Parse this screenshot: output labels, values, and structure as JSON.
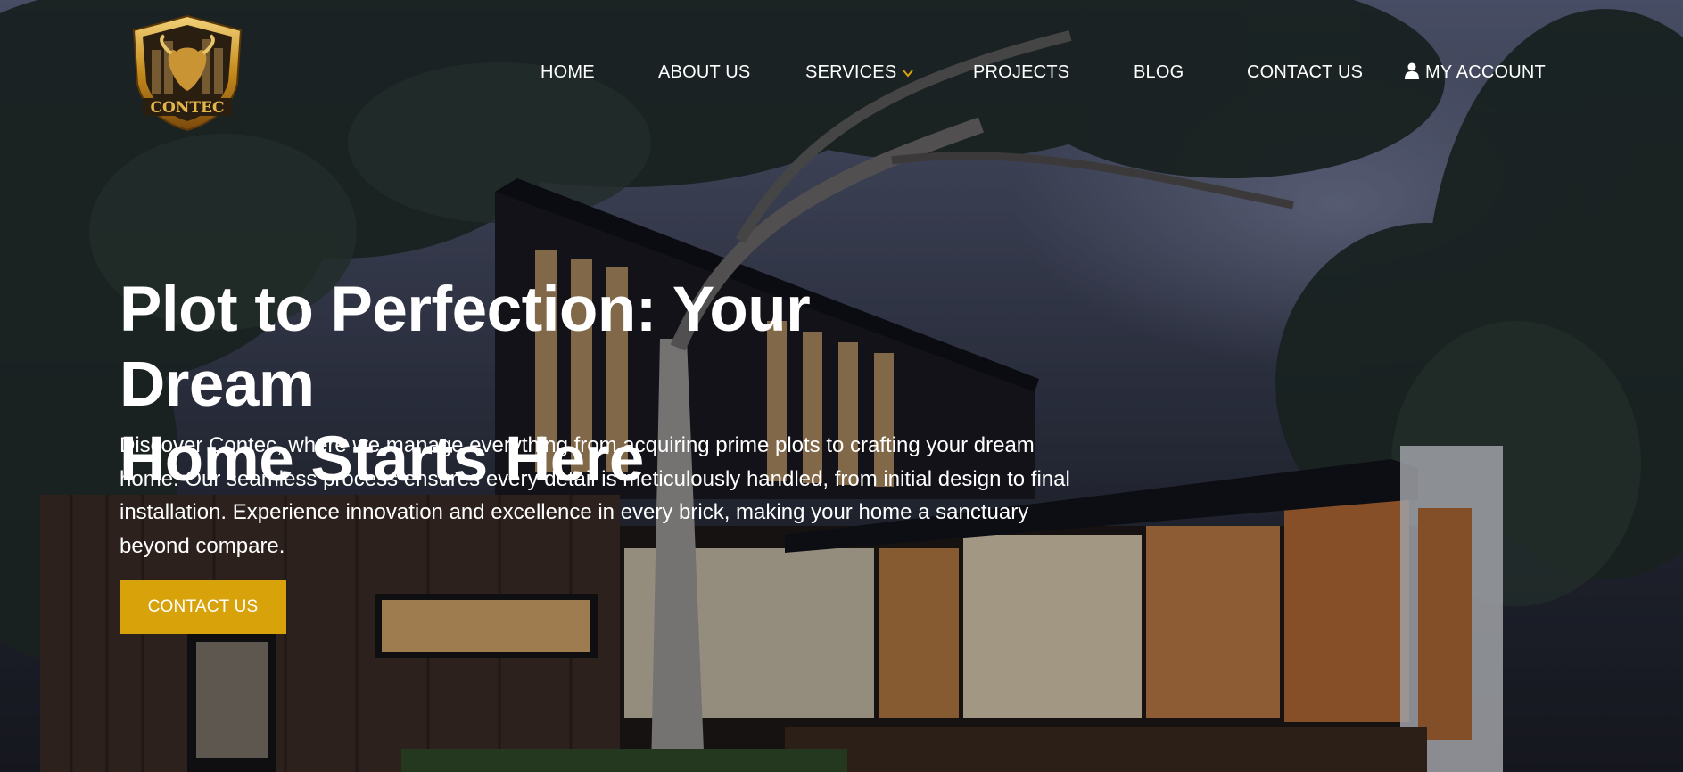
{
  "brand": {
    "logo_text": "CONTEC",
    "logo_icon": "bull-shield-logo-icon",
    "gold": "#d8a20b"
  },
  "nav": {
    "items": [
      {
        "label": "HOME"
      },
      {
        "label": "ABOUT US"
      },
      {
        "label": "SERVICES",
        "icon": "chevron-down-icon"
      },
      {
        "label": "PROJECTS"
      },
      {
        "label": "BLOG"
      },
      {
        "label": "CONTACT US"
      }
    ],
    "account": {
      "label": "MY ACCOUNT",
      "icon": "user-icon"
    }
  },
  "hero": {
    "headline_line1": "Plot to Perfection: Your Dream",
    "headline_line2": "Home Starts Here",
    "description": "Discover Contec, where we manage everything from acquiring prime plots to crafting your dream home. Our seamless process ensures every detail is meticulously handled, from initial design to final installation. Experience innovation and excellence in every brick, making your home a sanctuary beyond compare.",
    "cta_label": "CONTACT US",
    "background": "modern-house-at-dusk-image"
  }
}
